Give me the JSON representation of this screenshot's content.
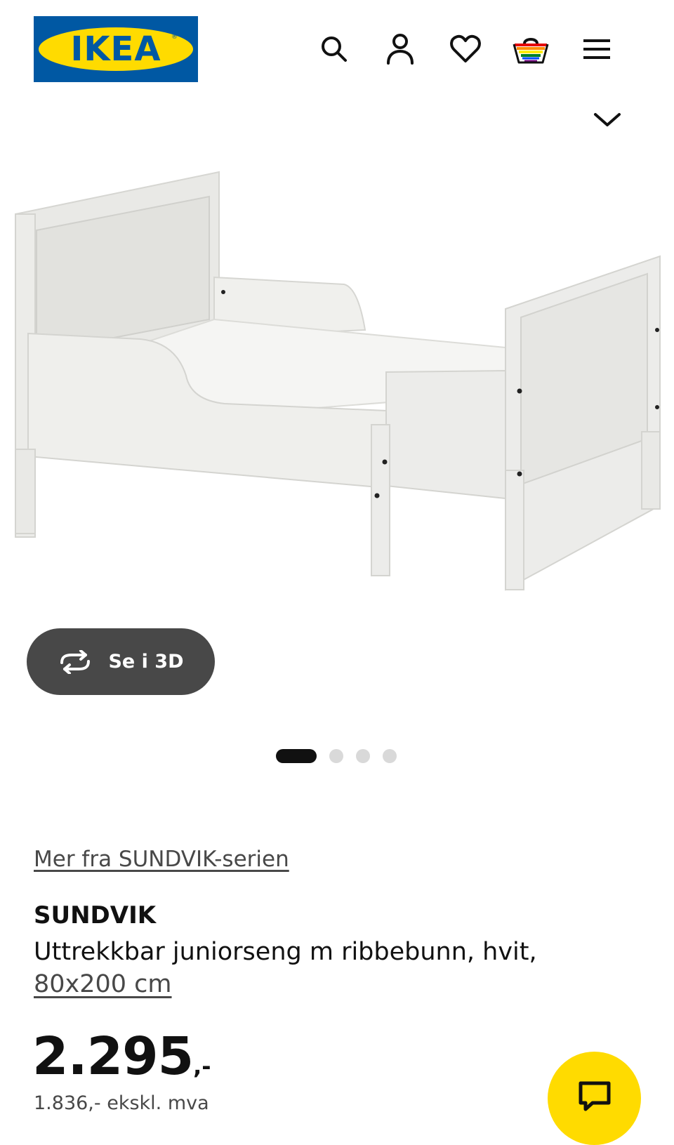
{
  "header": {
    "logo_text": "IKEA",
    "logo_reg": "®",
    "icons": [
      "search-icon",
      "account-icon",
      "heart-icon",
      "basket-icon",
      "menu-icon"
    ],
    "chevron_icon": "chevron-down-icon"
  },
  "gallery": {
    "view3d_label": "Se i 3D",
    "view3d_icon": "rotate-3d-icon",
    "slide_count": 4,
    "active_slide": 1
  },
  "product": {
    "series_link": "Mer fra SUNDVIK-serien",
    "name": "SUNDVIK",
    "description": "Uttrekkbar juniorseng m ribbebunn, hvit,",
    "size": "80x200 cm",
    "price": "2.295",
    "price_suffix": ",-",
    "price_excl_vat": "1.836,- ekskl. mva"
  },
  "colors": {
    "brand_blue": "#0058a3",
    "brand_yellow": "#ffdb00",
    "pill_dark": "#484848"
  }
}
